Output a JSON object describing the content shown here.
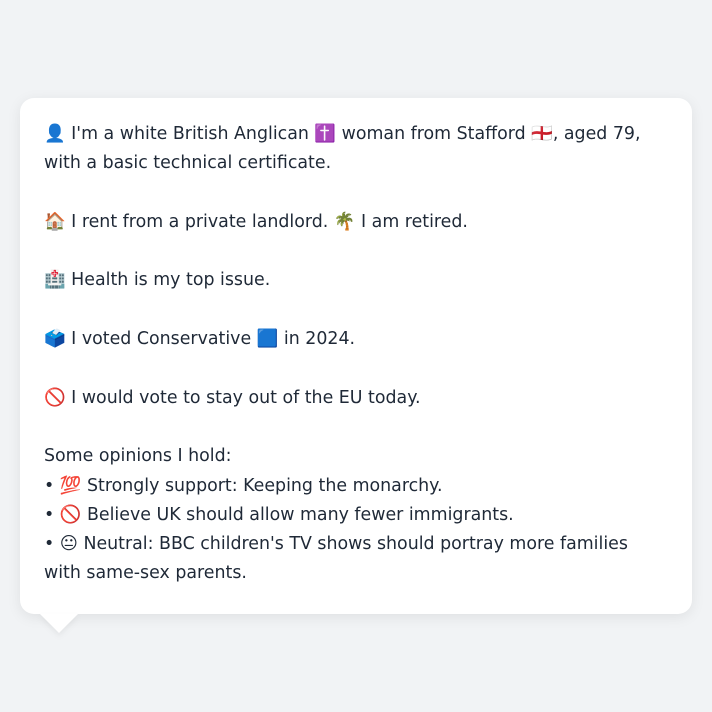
{
  "persona_card": {
    "intro": "👤 I'm a white British Anglican ✝️ woman from Stafford 🏴󠁧󠁢󠁥󠁮󠁧󠁿, aged 79, with a basic technical certificate.",
    "housing": "🏠 I rent from a private landlord. 🌴 I am retired.",
    "top_issue": "🏥 Health is my top issue.",
    "vote_2024": "🗳️ I voted Conservative 🟦 in 2024.",
    "eu_view": "🚫 I would vote to stay out of the EU today.",
    "opinions_heading": "Some opinions I hold:",
    "opinions": [
      "• 💯 Strongly support: Keeping the monarchy.",
      "• 🚫 Believe UK should allow many fewer immigrants.",
      "• 😐 Neutral: BBC children's TV shows should portray more families with same-sex parents."
    ]
  }
}
